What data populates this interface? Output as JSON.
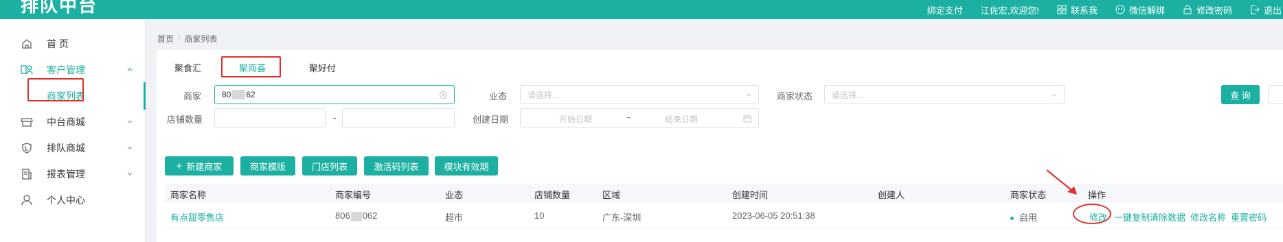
{
  "brand": {
    "logo_text": "排队中台",
    "accent": "#1bb0a1",
    "annotation_red": "#e0302b"
  },
  "topnav": {
    "bind_pay": "绑定支付",
    "welcome": "江佐宏,欢迎您!",
    "contact": "联系我",
    "wechat_unbind": "微信解绑",
    "change_password": "修改密码",
    "logout": "退出"
  },
  "sidebar": {
    "items": [
      {
        "label": "首 页",
        "icon": "home-icon"
      },
      {
        "label": "客户管理",
        "icon": "customer-icon"
      },
      {
        "label": "中台商城",
        "icon": "store-icon"
      },
      {
        "label": "排队商城",
        "icon": "shield-icon"
      },
      {
        "label": "报表管理",
        "icon": "report-icon"
      },
      {
        "label": "个人中心",
        "icon": "user-icon"
      }
    ],
    "sub_active": "商家列表"
  },
  "breadcrumb": {
    "home": "首页",
    "separator": "/",
    "current": "商家列表"
  },
  "tabs": [
    "聚食汇",
    "聚商荟",
    "聚好付"
  ],
  "active_tab": "聚商荟",
  "filters": {
    "merchant_label": "商家",
    "merchant_value_start": "80",
    "merchant_value_end": "62",
    "industry_label": "业态",
    "industry_placeholder": "请选择...",
    "status_label": "商家状态",
    "status_placeholder": "请选择...",
    "shop_count_label": "店铺数量",
    "range_dash": "-",
    "created_label": "创建日期",
    "start_placeholder": "开始日期",
    "date_sep": "~",
    "end_placeholder": "结束日期",
    "query_button": "查 询"
  },
  "actions": [
    "新建商家",
    "商家模版",
    "门店列表",
    "激活码列表",
    "模块有效期"
  ],
  "new_prefix": "+",
  "table": {
    "headers": [
      "商家名称",
      "商家编号",
      "业态",
      "店铺数量",
      "区域",
      "创建时间",
      "创建人",
      "商家状态",
      "操作"
    ],
    "rows": [
      {
        "name": "有点甜零售店",
        "code_start": "806",
        "code_end": "062",
        "industry": "超市",
        "shops": "10",
        "region": "广东-深圳",
        "created": "2023-06-05 20:51:38",
        "creator": "",
        "status": "启用",
        "ops": [
          "修改",
          "一键复制",
          "清除数据",
          "修改名称",
          "重置密码"
        ]
      }
    ]
  }
}
